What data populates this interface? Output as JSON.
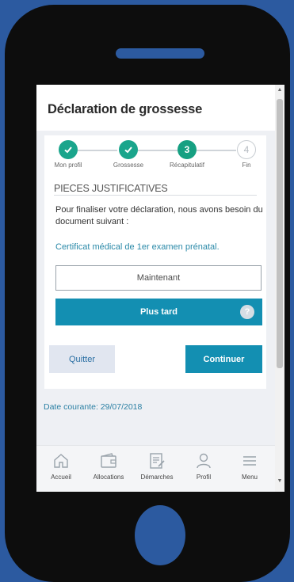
{
  "app": {
    "title": "Déclaration de grossesse"
  },
  "stepper": {
    "steps": [
      {
        "label": "Mon profil",
        "state": "done",
        "marker": ""
      },
      {
        "label": "Grossesse",
        "state": "done",
        "marker": ""
      },
      {
        "label": "Récapitulatif",
        "state": "current",
        "marker": "3"
      },
      {
        "label": "Fin",
        "state": "todo",
        "marker": "4"
      }
    ]
  },
  "section": {
    "title": "PIECES JUSTIFICATIVES",
    "intro": "Pour finaliser votre déclaration, nous avons besoin du document suivant :",
    "document": "Certificat médical de 1er examen prénatal."
  },
  "buttons": {
    "now": "Maintenant",
    "later": "Plus tard",
    "help": "?",
    "quit": "Quitter",
    "continue": "Continuer"
  },
  "footer": {
    "date": "Date courante: 29/07/2018"
  },
  "nav": {
    "items": [
      {
        "label": "Accueil",
        "icon": "home-icon"
      },
      {
        "label": "Allocations",
        "icon": "wallet-icon"
      },
      {
        "label": "Démarches",
        "icon": "document-edit-icon"
      },
      {
        "label": "Profil",
        "icon": "user-icon"
      },
      {
        "label": "Menu",
        "icon": "menu-icon"
      }
    ]
  },
  "colors": {
    "primary": "#138fb2",
    "success": "#1aa58c",
    "link": "#2a89a8",
    "frame": "#0d0d0d",
    "background": "#2c5aa0"
  }
}
